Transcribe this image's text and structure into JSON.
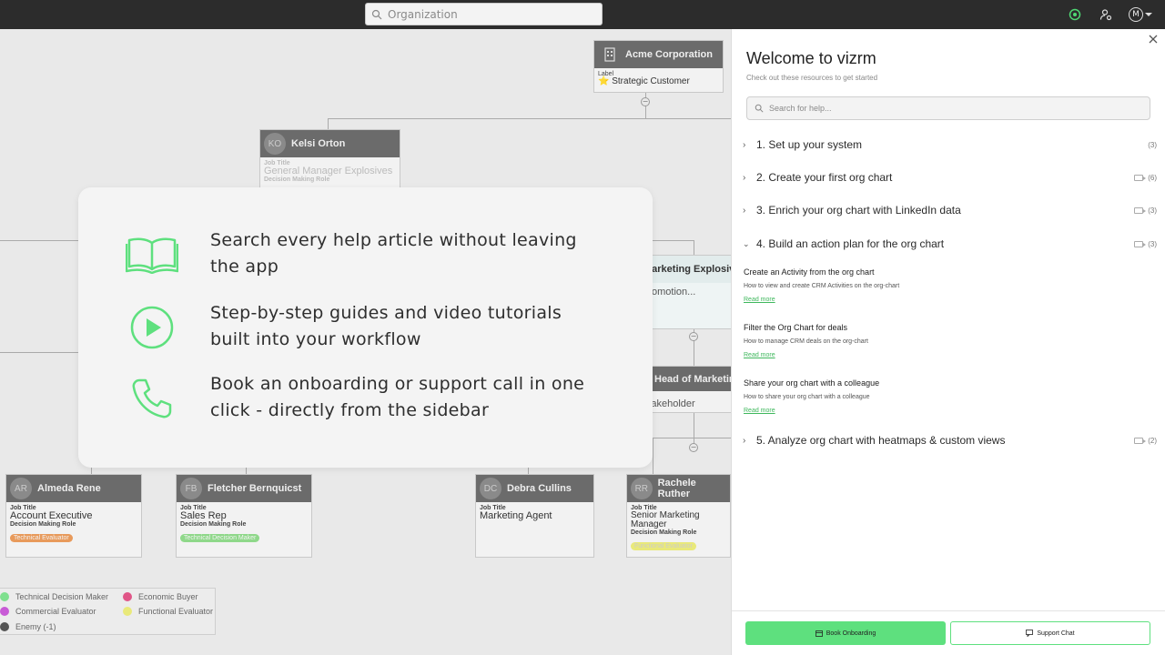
{
  "topbar": {
    "search_placeholder": "Organization",
    "avatar_initial": "M"
  },
  "org_chart": {
    "root": {
      "initials": "",
      "name": "Acme Corporation",
      "label_title": "Label",
      "label_value": "⭐ Strategic Customer"
    },
    "kelsi": {
      "initials": "KO",
      "name": "Kelsi Orton",
      "field1": "Job Title",
      "value1": "General Manager Explosives",
      "field2": "Decision Making Role"
    },
    "marketing_partial": {
      "name": "Marketing Explosive",
      "value": "Promotion..."
    },
    "head_partial": {
      "name": "Head of Marketing",
      "value": "Stakeholder"
    },
    "almeda": {
      "initials": "AR",
      "name": "Almeda Rene",
      "field1": "Job Title",
      "value1": "Account Executive",
      "field2": "Decision Making Role",
      "pill": "Technical Evaluator"
    },
    "fletcher": {
      "initials": "FB",
      "name": "Fletcher Bernquicst",
      "field1": "Job Title",
      "value1": "Sales Rep",
      "field2": "Decision Making Role",
      "pill": "Technical Decision Maker"
    },
    "debra": {
      "initials": "DC",
      "name": "Debra Cullins",
      "field1": "Job Title",
      "value1": "Marketing Agent"
    },
    "rachele": {
      "initials": "RR",
      "name": "Rachele Ruther",
      "field1": "Job Title",
      "value1": "Senior Marketing Manager",
      "field2": "Decision Making Role",
      "pill": "Functional Evaluator"
    }
  },
  "legend": {
    "items": [
      {
        "label": "Technical Decision Maker",
        "color": "#7fe08f"
      },
      {
        "label": "Economic Buyer",
        "color": "#e05587"
      },
      {
        "label": "Commercial Evaluator",
        "color": "#c85bd6"
      },
      {
        "label": "Functional Evaluator",
        "color": "#e9e97a"
      },
      {
        "label": "Enemy (-1)",
        "color": "#555555"
      }
    ]
  },
  "overlay": {
    "features": [
      {
        "icon": "book-icon",
        "text": "Search every help article without leaving the app"
      },
      {
        "icon": "play-icon",
        "text": "Step-by-step guides and video tutorials built into your workflow"
      },
      {
        "icon": "phone-icon",
        "text": "Book an onboarding or support call in one click - directly from the sidebar"
      }
    ]
  },
  "panel": {
    "title": "Welcome to vizrm",
    "subtitle": "Check out these resources to get started",
    "search_placeholder": "Search for help...",
    "sections": [
      {
        "label": "1. Set up your system",
        "count": "(3)",
        "video": false
      },
      {
        "label": "2. Create your first org chart",
        "count": "(6)",
        "video": true
      },
      {
        "label": "3. Enrich your org chart with LinkedIn data",
        "count": "(3)",
        "video": true
      },
      {
        "label": "4. Build an action plan for the org chart",
        "count": "(3)",
        "video": true,
        "expanded": true
      },
      {
        "label": "5. Analyze org chart with heatmaps & custom views",
        "count": "(2)",
        "video": true
      }
    ],
    "articles": [
      {
        "title": "Create an Activity from the org chart",
        "desc": "How to view and create CRM Activities on the org-chart",
        "link": "Read more"
      },
      {
        "title": "Filter the Org Chart for deals",
        "desc": "How to manage CRM deals on the org-chart",
        "link": "Read more"
      },
      {
        "title": "Share your org chart with a colleague",
        "desc": "How to share your org chart with a colleague",
        "link": "Read more"
      }
    ],
    "buttons": {
      "primary": "Book Onboarding",
      "secondary": "Support Chat"
    }
  },
  "colors": {
    "accent": "#5ee07e",
    "topbar": "#2c2c2c"
  }
}
